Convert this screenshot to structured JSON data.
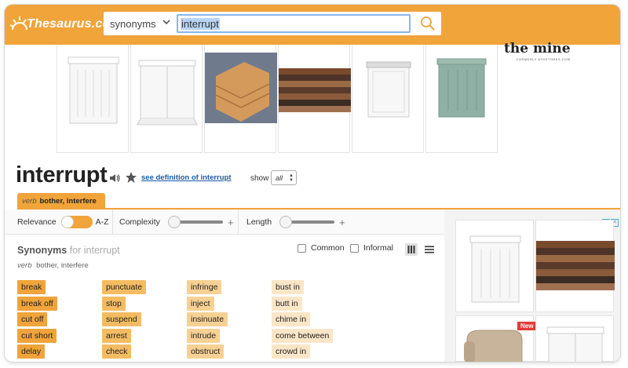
{
  "header": {
    "logo_text": "Thesaurus.com",
    "search_type": "synonyms",
    "search_value": "interrupt"
  },
  "ad_banner": {
    "brand": "the mine",
    "brand_sub": "FORMERLY ATGSTORES.COM"
  },
  "word": {
    "title": "interrupt",
    "definition_link": "see definition of interrupt",
    "show_label": "show",
    "show_value": "all"
  },
  "sense_tab": {
    "pos": "verb",
    "label": "bother, interfere"
  },
  "filters": {
    "relevance": "Relevance",
    "az": "A-Z",
    "complexity": "Complexity",
    "length": "Length",
    "plus": "+"
  },
  "synonyms": {
    "title": "Synonyms",
    "for_word": "for interrupt",
    "sense_pos": "verb",
    "sense_label": "bother, interfere",
    "common_label": "Common",
    "informal_label": "Informal",
    "columns": [
      [
        "break",
        "break off",
        "cut off",
        "cut short",
        "delay"
      ],
      [
        "punctuate",
        "stop",
        "suspend",
        "arrest",
        "check"
      ],
      [
        "infringe",
        "inject",
        "insinuate",
        "intrude",
        "obstruct"
      ],
      [
        "bust in",
        "butt in",
        "chime in",
        "come between",
        "crowd in"
      ]
    ]
  },
  "right_ad": {
    "new_badge": "New"
  },
  "colors": {
    "brand_orange": "#f0a43a",
    "relevance_1": "#f0a43a",
    "relevance_2": "#f4bc62",
    "relevance_3": "#f7d194",
    "relevance_4": "#fae6c7",
    "link_blue": "#1a5ca8"
  }
}
